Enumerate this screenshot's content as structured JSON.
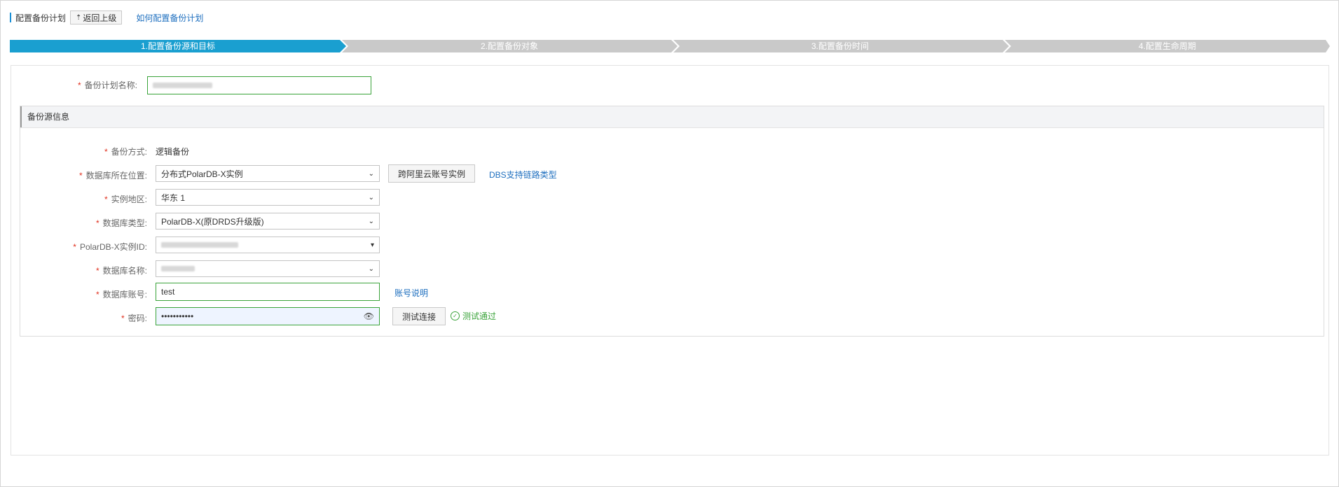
{
  "header": {
    "title": "配置备份计划",
    "back_label": "返回上级",
    "help_link": "如何配置备份计划"
  },
  "steps": [
    {
      "label": "1.配置备份源和目标",
      "active": true
    },
    {
      "label": "2.配置备份对象",
      "active": false
    },
    {
      "label": "3.配置备份时间",
      "active": false
    },
    {
      "label": "4.配置生命周期",
      "active": false
    }
  ],
  "plan": {
    "name_label": "备份计划名称:"
  },
  "source": {
    "section_title": "备份源信息",
    "method_label": "备份方式:",
    "method_value": "逻辑备份",
    "location_label": "数据库所在位置:",
    "location_value": "分布式PolarDB-X实例",
    "cross_account_button": "跨阿里云账号实例",
    "dbs_link": "DBS支持链路类型",
    "region_label": "实例地区:",
    "region_value": "华东 1",
    "db_type_label": "数据库类型:",
    "db_type_value": "PolarDB-X(原DRDS升级版)",
    "instance_id_label": "PolarDB-X实例ID:",
    "db_name_label": "数据库名称:",
    "account_label": "数据库账号:",
    "account_value": "test",
    "account_help_link": "账号说明",
    "password_label": "密码:",
    "password_value": "•••••••••••",
    "test_button": "测试连接",
    "test_result": "测试通过"
  },
  "colors": {
    "accent": "#1a9fd0",
    "step_inactive": "#c9c9c9",
    "required": "#e0301e",
    "success": "#3aa33a",
    "link": "#1e6fbf"
  }
}
